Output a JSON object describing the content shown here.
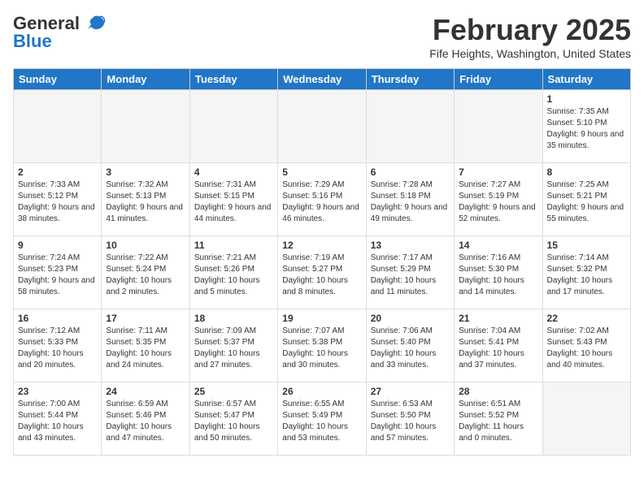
{
  "header": {
    "logo_line1": "General",
    "logo_line2": "Blue",
    "month_title": "February 2025",
    "location": "Fife Heights, Washington, United States"
  },
  "days_of_week": [
    "Sunday",
    "Monday",
    "Tuesday",
    "Wednesday",
    "Thursday",
    "Friday",
    "Saturday"
  ],
  "weeks": [
    [
      {
        "day": "",
        "info": "",
        "empty": true
      },
      {
        "day": "",
        "info": "",
        "empty": true
      },
      {
        "day": "",
        "info": "",
        "empty": true
      },
      {
        "day": "",
        "info": "",
        "empty": true
      },
      {
        "day": "",
        "info": "",
        "empty": true
      },
      {
        "day": "",
        "info": "",
        "empty": true
      },
      {
        "day": "1",
        "info": "Sunrise: 7:35 AM\nSunset: 5:10 PM\nDaylight: 9 hours and 35 minutes.",
        "empty": false
      }
    ],
    [
      {
        "day": "2",
        "info": "Sunrise: 7:33 AM\nSunset: 5:12 PM\nDaylight: 9 hours and 38 minutes.",
        "empty": false
      },
      {
        "day": "3",
        "info": "Sunrise: 7:32 AM\nSunset: 5:13 PM\nDaylight: 9 hours and 41 minutes.",
        "empty": false
      },
      {
        "day": "4",
        "info": "Sunrise: 7:31 AM\nSunset: 5:15 PM\nDaylight: 9 hours and 44 minutes.",
        "empty": false
      },
      {
        "day": "5",
        "info": "Sunrise: 7:29 AM\nSunset: 5:16 PM\nDaylight: 9 hours and 46 minutes.",
        "empty": false
      },
      {
        "day": "6",
        "info": "Sunrise: 7:28 AM\nSunset: 5:18 PM\nDaylight: 9 hours and 49 minutes.",
        "empty": false
      },
      {
        "day": "7",
        "info": "Sunrise: 7:27 AM\nSunset: 5:19 PM\nDaylight: 9 hours and 52 minutes.",
        "empty": false
      },
      {
        "day": "8",
        "info": "Sunrise: 7:25 AM\nSunset: 5:21 PM\nDaylight: 9 hours and 55 minutes.",
        "empty": false
      }
    ],
    [
      {
        "day": "9",
        "info": "Sunrise: 7:24 AM\nSunset: 5:23 PM\nDaylight: 9 hours and 58 minutes.",
        "empty": false
      },
      {
        "day": "10",
        "info": "Sunrise: 7:22 AM\nSunset: 5:24 PM\nDaylight: 10 hours and 2 minutes.",
        "empty": false
      },
      {
        "day": "11",
        "info": "Sunrise: 7:21 AM\nSunset: 5:26 PM\nDaylight: 10 hours and 5 minutes.",
        "empty": false
      },
      {
        "day": "12",
        "info": "Sunrise: 7:19 AM\nSunset: 5:27 PM\nDaylight: 10 hours and 8 minutes.",
        "empty": false
      },
      {
        "day": "13",
        "info": "Sunrise: 7:17 AM\nSunset: 5:29 PM\nDaylight: 10 hours and 11 minutes.",
        "empty": false
      },
      {
        "day": "14",
        "info": "Sunrise: 7:16 AM\nSunset: 5:30 PM\nDaylight: 10 hours and 14 minutes.",
        "empty": false
      },
      {
        "day": "15",
        "info": "Sunrise: 7:14 AM\nSunset: 5:32 PM\nDaylight: 10 hours and 17 minutes.",
        "empty": false
      }
    ],
    [
      {
        "day": "16",
        "info": "Sunrise: 7:12 AM\nSunset: 5:33 PM\nDaylight: 10 hours and 20 minutes.",
        "empty": false
      },
      {
        "day": "17",
        "info": "Sunrise: 7:11 AM\nSunset: 5:35 PM\nDaylight: 10 hours and 24 minutes.",
        "empty": false
      },
      {
        "day": "18",
        "info": "Sunrise: 7:09 AM\nSunset: 5:37 PM\nDaylight: 10 hours and 27 minutes.",
        "empty": false
      },
      {
        "day": "19",
        "info": "Sunrise: 7:07 AM\nSunset: 5:38 PM\nDaylight: 10 hours and 30 minutes.",
        "empty": false
      },
      {
        "day": "20",
        "info": "Sunrise: 7:06 AM\nSunset: 5:40 PM\nDaylight: 10 hours and 33 minutes.",
        "empty": false
      },
      {
        "day": "21",
        "info": "Sunrise: 7:04 AM\nSunset: 5:41 PM\nDaylight: 10 hours and 37 minutes.",
        "empty": false
      },
      {
        "day": "22",
        "info": "Sunrise: 7:02 AM\nSunset: 5:43 PM\nDaylight: 10 hours and 40 minutes.",
        "empty": false
      }
    ],
    [
      {
        "day": "23",
        "info": "Sunrise: 7:00 AM\nSunset: 5:44 PM\nDaylight: 10 hours and 43 minutes.",
        "empty": false
      },
      {
        "day": "24",
        "info": "Sunrise: 6:59 AM\nSunset: 5:46 PM\nDaylight: 10 hours and 47 minutes.",
        "empty": false
      },
      {
        "day": "25",
        "info": "Sunrise: 6:57 AM\nSunset: 5:47 PM\nDaylight: 10 hours and 50 minutes.",
        "empty": false
      },
      {
        "day": "26",
        "info": "Sunrise: 6:55 AM\nSunset: 5:49 PM\nDaylight: 10 hours and 53 minutes.",
        "empty": false
      },
      {
        "day": "27",
        "info": "Sunrise: 6:53 AM\nSunset: 5:50 PM\nDaylight: 10 hours and 57 minutes.",
        "empty": false
      },
      {
        "day": "28",
        "info": "Sunrise: 6:51 AM\nSunset: 5:52 PM\nDaylight: 11 hours and 0 minutes.",
        "empty": false
      },
      {
        "day": "",
        "info": "",
        "empty": true
      }
    ]
  ]
}
